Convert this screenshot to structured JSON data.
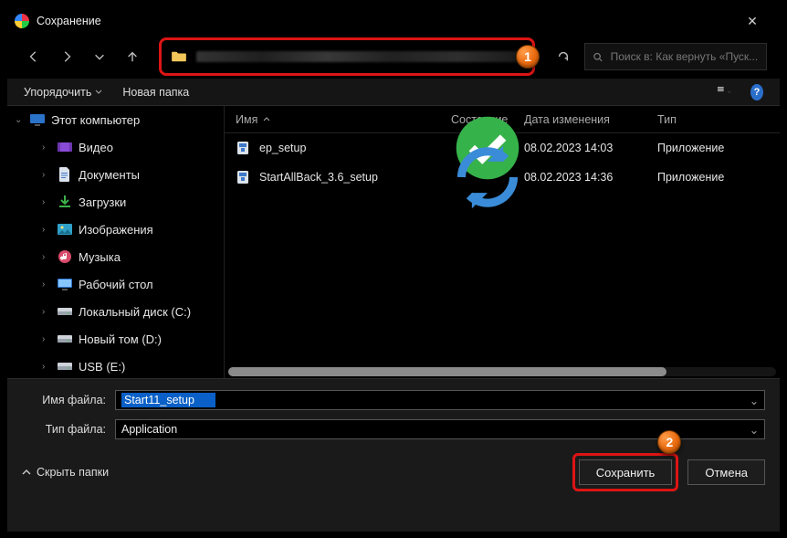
{
  "window": {
    "title": "Сохранение",
    "close_glyph": "✕"
  },
  "nav": {
    "refresh_glyph": "↻"
  },
  "search": {
    "placeholder": "Поиск в: Как вернуть «Пуск..."
  },
  "markers": {
    "one": "1",
    "two": "2"
  },
  "toolbar": {
    "organize": "Упорядочить",
    "newfolder": "Новая папка",
    "help_glyph": "?"
  },
  "tree": {
    "root": "Этот компьютер",
    "items": [
      {
        "label": "Видео",
        "icon": "video"
      },
      {
        "label": "Документы",
        "icon": "doc"
      },
      {
        "label": "Загрузки",
        "icon": "download"
      },
      {
        "label": "Изображения",
        "icon": "image"
      },
      {
        "label": "Музыка",
        "icon": "music"
      },
      {
        "label": "Рабочий стол",
        "icon": "desktop"
      },
      {
        "label": "Локальный диск (C:)",
        "icon": "disk"
      },
      {
        "label": "Новый том (D:)",
        "icon": "disk"
      },
      {
        "label": "USB (E:)",
        "icon": "disk"
      }
    ]
  },
  "list": {
    "headers": {
      "name": "Имя",
      "state": "Состояние",
      "date": "Дата изменения",
      "type": "Тип"
    },
    "rows": [
      {
        "name": "ep_setup",
        "state": "ok",
        "date": "08.02.2023 14:03",
        "type": "Приложение"
      },
      {
        "name": "StartAllBack_3.6_setup",
        "state": "sync",
        "date": "08.02.2023 14:36",
        "type": "Приложение"
      }
    ]
  },
  "form": {
    "filename_label": "Имя файла:",
    "filename_value": "Start11_setup",
    "filetype_label": "Тип файла:",
    "filetype_value": "Application"
  },
  "footer": {
    "hide": "Скрыть папки",
    "save": "Сохранить",
    "cancel": "Отмена"
  }
}
